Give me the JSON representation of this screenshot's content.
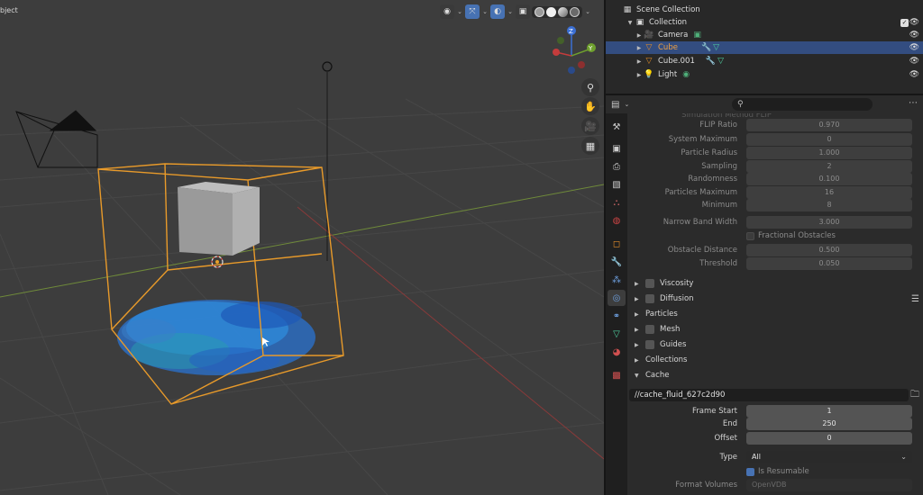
{
  "viewport": {
    "mode_label": "bject",
    "nav_buttons": [
      "zoom-icon",
      "hand-icon",
      "camera-icon",
      "grid-icon"
    ]
  },
  "outliner": {
    "scene_collection": "Scene Collection",
    "collection": "Collection",
    "objects": [
      {
        "label": "Camera",
        "selected": false,
        "icon": "camera-icon"
      },
      {
        "label": "Cube",
        "selected": true,
        "icon": "mesh-icon"
      },
      {
        "label": "Cube.001",
        "selected": false,
        "icon": "mesh-icon"
      },
      {
        "label": "Light",
        "selected": false,
        "icon": "light-icon"
      }
    ]
  },
  "properties": {
    "search_placeholder": "",
    "cut_off_label": "Simulation Method  FLIP",
    "fields": [
      {
        "label": "FLIP Ratio",
        "value": "0.970"
      },
      {
        "label": "System Maximum",
        "value": "0"
      },
      {
        "label": "Particle Radius",
        "value": "1.000"
      },
      {
        "label": "Sampling",
        "value": "2"
      },
      {
        "label": "Randomness",
        "value": "0.100"
      },
      {
        "label": "Particles Maximum",
        "value": "16"
      },
      {
        "label": "Minimum",
        "value": "8"
      },
      {
        "label": "Narrow Band Width",
        "value": "3.000"
      }
    ],
    "fractional_obstacles": "Fractional Obstacles",
    "obstacle_fields": [
      {
        "label": "Obstacle Distance",
        "value": "0.500"
      },
      {
        "label": "Threshold",
        "value": "0.050"
      }
    ],
    "panels": [
      {
        "label": "Viscosity",
        "checkbox": true,
        "open": false
      },
      {
        "label": "Diffusion",
        "checkbox": true,
        "open": false
      },
      {
        "label": "Particles",
        "checkbox": false,
        "open": false
      },
      {
        "label": "Mesh",
        "checkbox": true,
        "open": false
      },
      {
        "label": "Guides",
        "checkbox": true,
        "open": false
      },
      {
        "label": "Collections",
        "checkbox": false,
        "open": false
      },
      {
        "label": "Cache",
        "checkbox": false,
        "open": true
      }
    ],
    "cache": {
      "path": "//cache_fluid_627c2d90",
      "frame_start_label": "Frame Start",
      "frame_start": "1",
      "end_label": "End",
      "end": "250",
      "offset_label": "Offset",
      "offset": "0",
      "type_label": "Type",
      "type": "All",
      "is_resumable": "Is Resumable",
      "format_volumes_label": "Format Volumes",
      "format_volumes": "OpenVDB"
    }
  }
}
